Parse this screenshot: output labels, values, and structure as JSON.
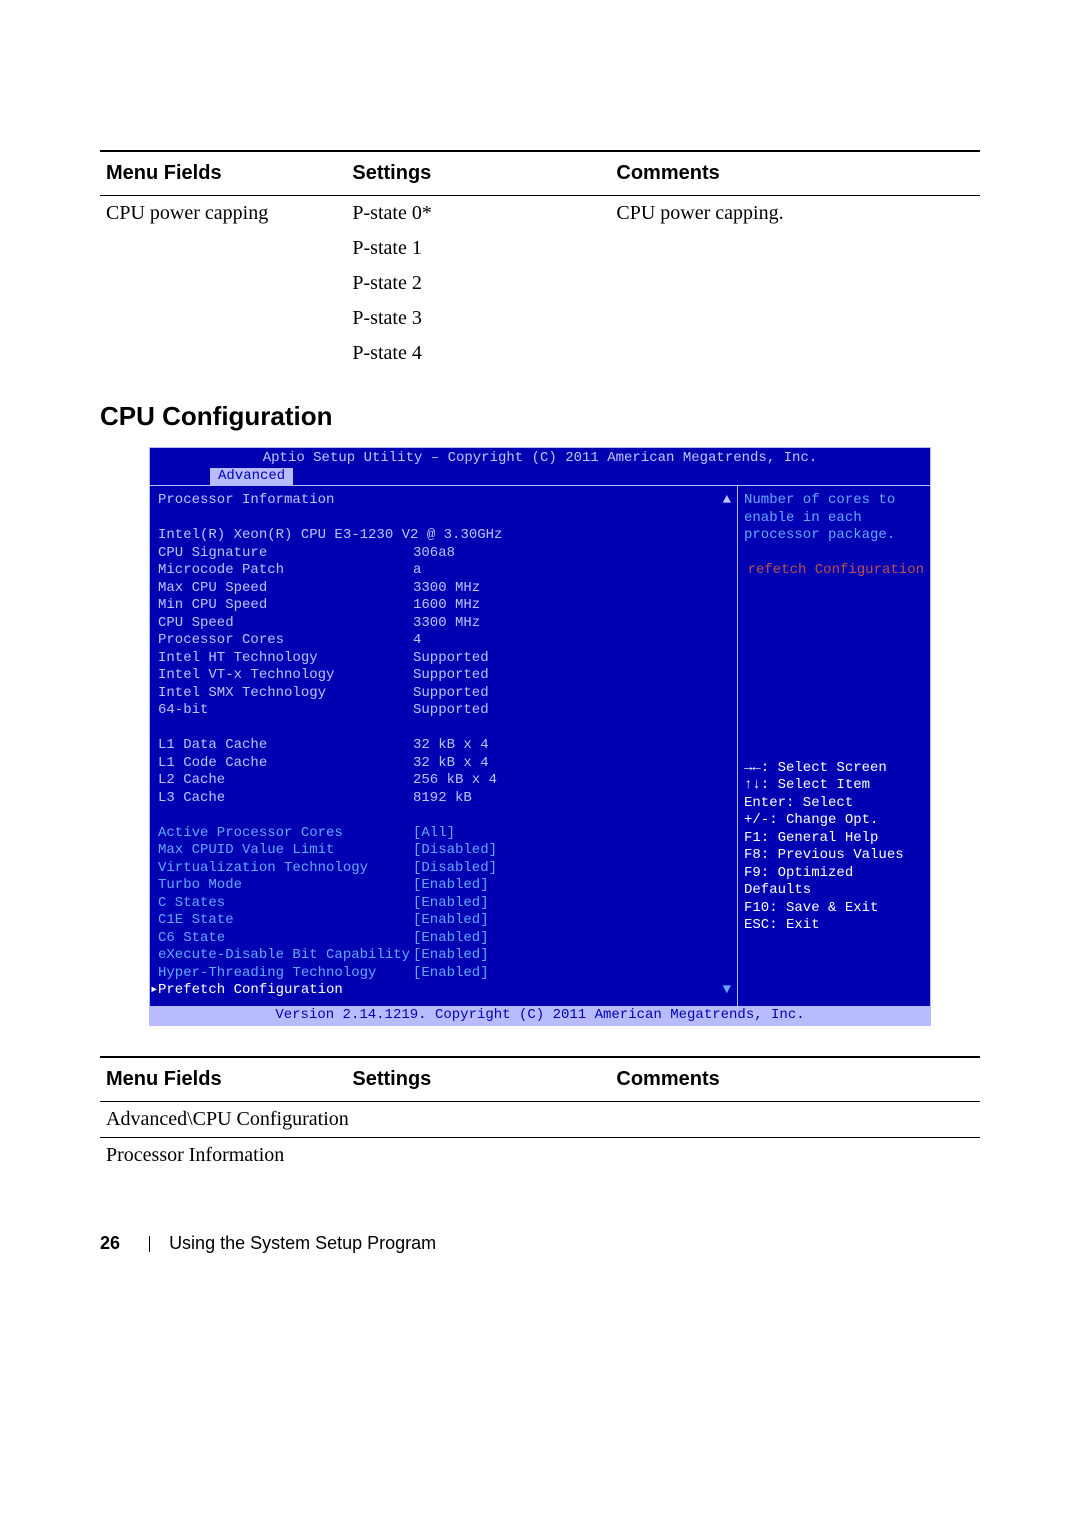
{
  "table1": {
    "headers": [
      "Menu Fields",
      "Settings",
      "Comments"
    ],
    "field": "CPU power capping",
    "settings": [
      "P-state 0*",
      "P-state 1",
      "P-state 2",
      "P-state 3",
      "P-state 4"
    ],
    "comment": "CPU power capping."
  },
  "section_heading": "CPU Configuration",
  "bios": {
    "title": "Aptio Setup Utility – Copyright (C) 2011 American Megatrends, Inc.",
    "tab": "Advanced",
    "header": "Processor Information",
    "cpu_name": "Intel(R) Xeon(R) CPU E3-1230 V2 @ 3.30GHz",
    "info_rows": [
      {
        "l": "CPU Signature",
        "v": "306a8"
      },
      {
        "l": "Microcode Patch",
        "v": "a"
      },
      {
        "l": "Max CPU Speed",
        "v": "3300 MHz"
      },
      {
        "l": "Min CPU Speed",
        "v": "1600 MHz"
      },
      {
        "l": "CPU Speed",
        "v": "3300 MHz"
      },
      {
        "l": "Processor Cores",
        "v": "4"
      },
      {
        "l": "Intel HT Technology",
        "v": "Supported"
      },
      {
        "l": "Intel VT-x Technology",
        "v": "Supported"
      },
      {
        "l": "Intel SMX Technology",
        "v": "Supported"
      },
      {
        "l": "64-bit",
        "v": "Supported"
      }
    ],
    "cache_rows": [
      {
        "l": "L1 Data Cache",
        "v": "32 kB x 4"
      },
      {
        "l": "L1 Code Cache",
        "v": "32 kB x 4"
      },
      {
        "l": "L2 Cache",
        "v": "256 kB x 4"
      },
      {
        "l": "L3 Cache",
        "v": "8192 kB"
      }
    ],
    "opt_rows": [
      {
        "l": "Active Processor Cores",
        "v": "[All]"
      },
      {
        "l": "Max CPUID Value Limit",
        "v": "[Disabled]"
      },
      {
        "l": "Virtualization Technology",
        "v": "[Disabled]"
      },
      {
        "l": "Turbo Mode",
        "v": "[Enabled]"
      },
      {
        "l": "C States",
        "v": "[Enabled]"
      },
      {
        "l": "C1E State",
        "v": "[Enabled]"
      },
      {
        "l": "C6 State",
        "v": "[Enabled]"
      },
      {
        "l": "eXecute-Disable Bit Capability",
        "v": "[Enabled]"
      },
      {
        "l": "Hyper-Threading Technology",
        "v": "[Enabled]"
      }
    ],
    "selected_row": {
      "l": "Prefetch Configuration",
      "v": ""
    },
    "help_top": [
      "Number of cores to",
      "enable in each",
      "processor package."
    ],
    "help_extra": "refetch Configuration",
    "help_cmds": [
      "→←: Select Screen",
      "↑↓: Select Item",
      "Enter: Select",
      "+/-: Change Opt.",
      "F1: General Help",
      "F8: Previous Values",
      "F9: Optimized Defaults",
      "F10: Save & Exit",
      "ESC: Exit"
    ],
    "footer": "Version 2.14.1219. Copyright (C) 2011 American Megatrends, Inc."
  },
  "table2": {
    "headers": [
      "Menu Fields",
      "Settings",
      "Comments"
    ],
    "row1": "Advanced\\CPU Configuration",
    "row2": "Processor Information"
  },
  "page_footer": {
    "num": "26",
    "text": "Using the System Setup Program"
  }
}
